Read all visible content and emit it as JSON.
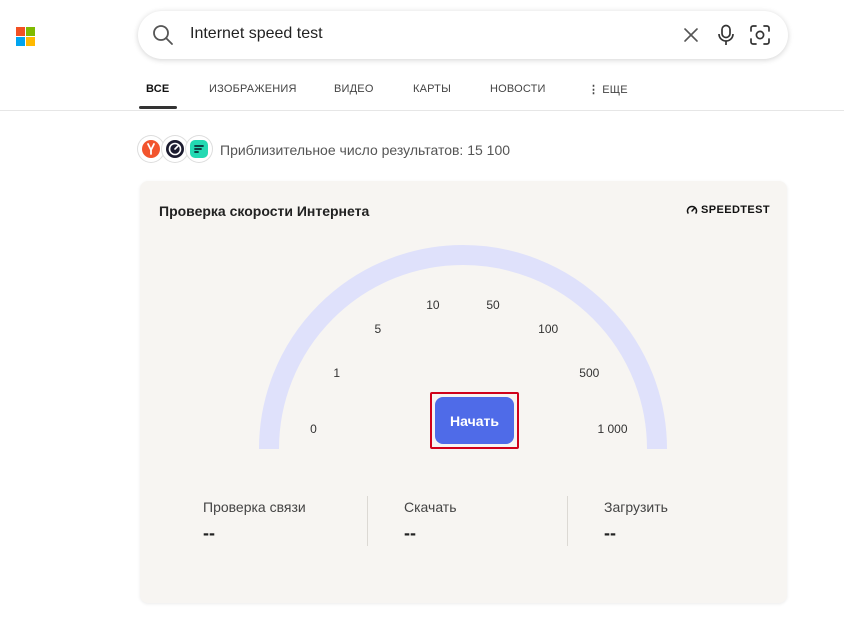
{
  "logo": {
    "colors": [
      "#f25022",
      "#7fba00",
      "#00a4ef",
      "#ffb900"
    ]
  },
  "search": {
    "query": "Internet speed test"
  },
  "tabs": [
    {
      "label": "ВСЕ",
      "active": true
    },
    {
      "label": "ИЗОБРАЖЕНИЯ"
    },
    {
      "label": "ВИДЕО"
    },
    {
      "label": "КАРТЫ"
    },
    {
      "label": "НОВОСТИ"
    },
    {
      "label": "ЕЩЕ",
      "icon": "more-vertical-icon"
    }
  ],
  "results": {
    "count_text": "Приблизительное число результатов: 15 100"
  },
  "sources": [
    {
      "name": "yandex-icon",
      "color": "#f2542d"
    },
    {
      "name": "speedometer-icon",
      "color": "#1b1b2f"
    },
    {
      "name": "fast-icon",
      "color": "#23d9b2"
    }
  ],
  "widget": {
    "title": "Проверка скорости Интернета",
    "brand": "SPEEDTEST",
    "gauge_ticks": [
      "0",
      "1",
      "5",
      "10",
      "50",
      "100",
      "500",
      "1 000"
    ],
    "gauge_fill": 0,
    "start_label": "Начать",
    "accent": "#4f6be8",
    "arc_color": "#dfe1fb",
    "metrics": [
      {
        "label": "Проверка связи",
        "value": "--"
      },
      {
        "label": "Скачать",
        "value": "--"
      },
      {
        "label": "Загрузить",
        "value": "--"
      }
    ]
  }
}
